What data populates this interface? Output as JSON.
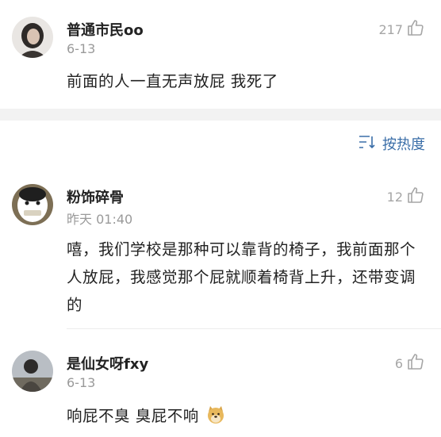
{
  "comments": [
    {
      "username": "普通市民oo",
      "date": "6-13",
      "likes": "217",
      "text": "前面的人一直无声放屁 我死了"
    },
    {
      "username": "粉饰碎骨",
      "date": "昨天 01:40",
      "likes": "12",
      "text": "嘻，我们学校是那种可以靠背的椅子，我前面那个人放屁，我感觉那个屁就顺着椅背上升，还带变调的"
    },
    {
      "username": "是仙女呀fxy",
      "date": "6-13",
      "likes": "6",
      "text": "响屁不臭 臭屁不响"
    }
  ],
  "sort": {
    "label": "按热度"
  },
  "icons": {
    "like": "thumbs-up-icon",
    "sort": "sort-icon",
    "emoji": "doge-emoji-icon"
  },
  "colors": {
    "accent": "#3a6ea8",
    "muted": "#9a9a9a",
    "band": "#f2f2f2"
  }
}
